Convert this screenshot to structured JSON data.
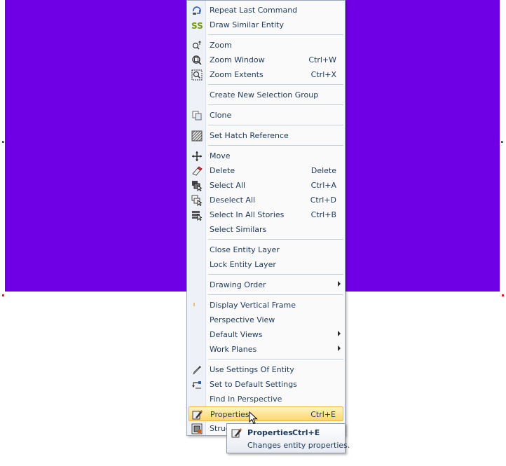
{
  "menu": {
    "items": [
      {
        "label": "Repeat Last Command",
        "shortcut": "",
        "icon": "repeat-icon"
      },
      {
        "label": "Draw Similar Entity",
        "shortcut": "",
        "icon": "draw-similar-icon"
      },
      {
        "label": "Zoom",
        "shortcut": "",
        "icon": "zoom-icon"
      },
      {
        "label": "Zoom Window",
        "shortcut": "Ctrl+W",
        "icon": "zoom-window-icon"
      },
      {
        "label": "Zoom Extents",
        "shortcut": "Ctrl+X",
        "icon": "zoom-extents-icon"
      },
      {
        "label": "Create New Selection Group",
        "shortcut": "",
        "icon": ""
      },
      {
        "label": "Clone",
        "shortcut": "",
        "icon": "clone-icon"
      },
      {
        "label": "Set Hatch Reference",
        "shortcut": "",
        "icon": "hatch-icon"
      },
      {
        "label": "Move",
        "shortcut": "",
        "icon": "move-icon"
      },
      {
        "label": "Delete",
        "shortcut": "Delete",
        "icon": "eraser-icon"
      },
      {
        "label": "Select All",
        "shortcut": "Ctrl+A",
        "icon": "select-all-icon"
      },
      {
        "label": "Deselect All",
        "shortcut": "Ctrl+D",
        "icon": "deselect-all-icon"
      },
      {
        "label": "Select In All Stories",
        "shortcut": "Ctrl+B",
        "icon": "select-stories-icon"
      },
      {
        "label": "Select Similars",
        "shortcut": "",
        "icon": ""
      },
      {
        "label": "Close Entity Layer",
        "shortcut": "",
        "icon": ""
      },
      {
        "label": "Lock Entity Layer",
        "shortcut": "",
        "icon": ""
      },
      {
        "label": "Drawing Order",
        "shortcut": "",
        "icon": "",
        "submenu": true
      },
      {
        "label": "Display Vertical Frame",
        "shortcut": "",
        "icon": ""
      },
      {
        "label": "Perspective View",
        "shortcut": "",
        "icon": ""
      },
      {
        "label": "Default Views",
        "shortcut": "",
        "icon": "",
        "submenu": true
      },
      {
        "label": "Work Planes",
        "shortcut": "",
        "icon": "",
        "submenu": true
      },
      {
        "label": "Use Settings Of Entity",
        "shortcut": "",
        "icon": "eyedropper-icon"
      },
      {
        "label": "Set to Default Settings",
        "shortcut": "",
        "icon": "default-settings-icon"
      },
      {
        "label": "Find In Perspective",
        "shortcut": "",
        "icon": ""
      },
      {
        "label": "Properties",
        "shortcut": "Ctrl+E",
        "icon": "properties-icon",
        "highlighted": true
      },
      {
        "label": "Struc",
        "shortcut": "",
        "icon": "structure-icon"
      }
    ]
  },
  "tooltip": {
    "title": "Properties",
    "shortcut": "Ctrl+E",
    "description": "Changes entity properties."
  },
  "colors": {
    "canvas": "#6f00e6",
    "highlight": "#ffd66b",
    "text": "#1e395b"
  }
}
